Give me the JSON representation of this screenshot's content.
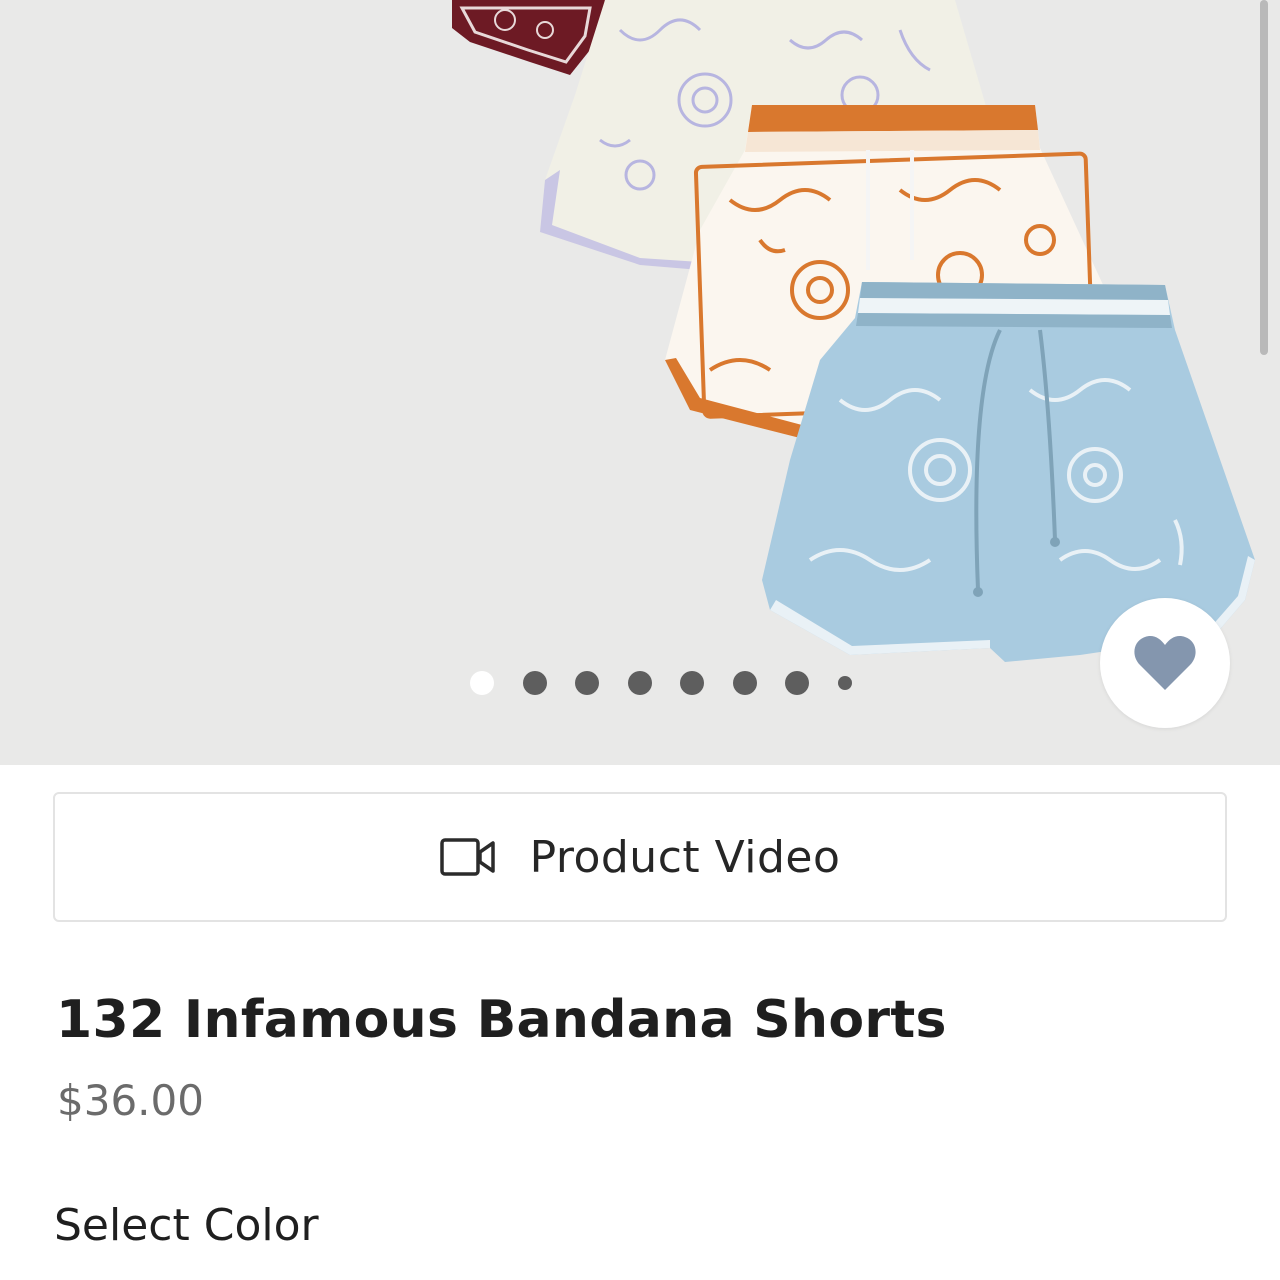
{
  "gallery": {
    "image_alt": "",
    "dots_total": 8,
    "active_index": 0
  },
  "favorite": {
    "icon": "heart-icon",
    "color": "#8496ae"
  },
  "video_button": {
    "icon": "video-camera-icon",
    "label": "Product Video"
  },
  "product": {
    "title": "132 Infamous Bandana Shorts",
    "price": "$36.00"
  },
  "options": {
    "select_color_label": "Select Color"
  },
  "colors": {
    "gallery_bg": "#e9e9e8",
    "short_maroon": "#6d1a24",
    "short_cream": "#f1f0e6",
    "short_orange": "#d9782e",
    "short_blue": "#a9cbe0"
  }
}
